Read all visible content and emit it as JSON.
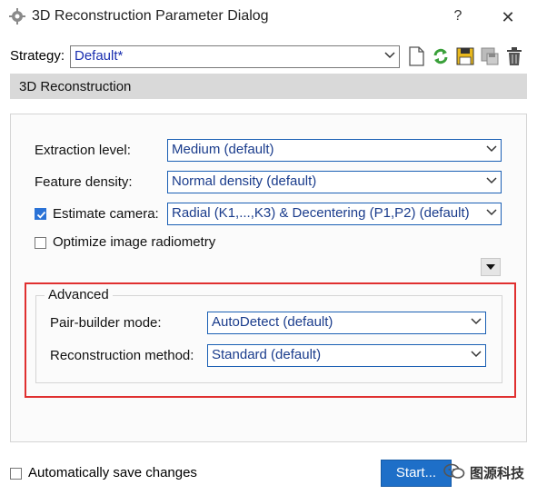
{
  "window": {
    "title": "3D Reconstruction Parameter Dialog",
    "help_label": "?",
    "close_label": "✕"
  },
  "strategy": {
    "label": "Strategy:",
    "value": "Default*",
    "tools": [
      "new-document-icon",
      "refresh-icon",
      "save-icon",
      "save-as-icon",
      "delete-icon"
    ]
  },
  "section": {
    "title": "3D Reconstruction"
  },
  "fields": {
    "extraction_level": {
      "label": "Extraction level:",
      "value": "Medium (default)"
    },
    "feature_density": {
      "label": "Feature density:",
      "value": "Normal density (default)"
    },
    "estimate_camera": {
      "label": "Estimate camera:",
      "checked": true,
      "value": "Radial (K1,...,K3) & Decentering (P1,P2) (default)"
    },
    "optimize_radiometry": {
      "label": "Optimize image radiometry",
      "checked": false
    }
  },
  "advanced": {
    "title": "Advanced",
    "pair_builder": {
      "label": "Pair-builder mode:",
      "value": "AutoDetect (default)"
    },
    "reconstruction": {
      "label": "Reconstruction method:",
      "value": "Standard (default)"
    }
  },
  "footer": {
    "autosave_label": "Automatically save changes",
    "autosave_checked": false,
    "start_label": "Start...",
    "watermark_text": "图源科技"
  },
  "colors": {
    "accent": "#1e6fc8",
    "highlight": "#e03030",
    "combo_text": "#1a3c8c"
  }
}
